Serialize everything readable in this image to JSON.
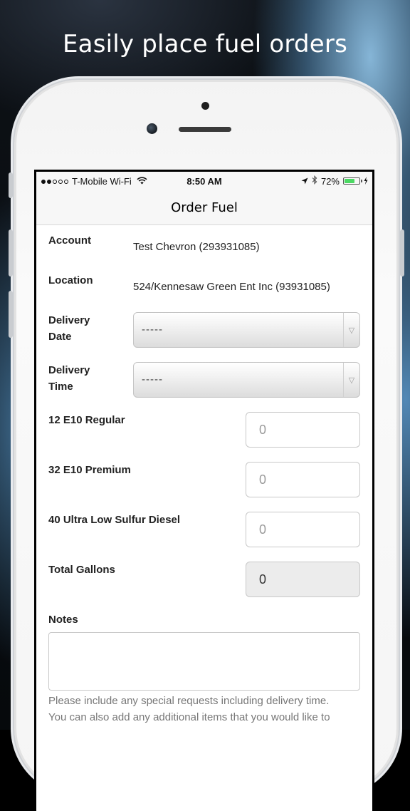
{
  "promo": {
    "headline": "Easily place fuel orders"
  },
  "status_bar": {
    "carrier": "T-Mobile Wi-Fi",
    "time": "8:50 AM",
    "battery": "72%",
    "battery_level": 0.72,
    "battery_color": "#4cd964",
    "icons": [
      "signal-dots-icon",
      "wifi-icon",
      "location-arrow-icon",
      "bluetooth-icon",
      "battery-icon",
      "charging-bolt-icon"
    ]
  },
  "navbar": {
    "title": "Order Fuel"
  },
  "form": {
    "account": {
      "label": "Account",
      "value": "Test Chevron (293931085)"
    },
    "location": {
      "label": "Location",
      "value": "524/Kennesaw Green Ent Inc (93931085)"
    },
    "delivery_date": {
      "label_line1": "Delivery",
      "label_line2": "Date",
      "selected": "-----"
    },
    "delivery_time": {
      "label_line1": "Delivery",
      "label_line2": "Time",
      "selected": "-----"
    },
    "products": [
      {
        "label": "12 E10 Regular",
        "placeholder": "0"
      },
      {
        "label": "32 E10 Premium",
        "placeholder": "0"
      },
      {
        "label": "40 Ultra Low Sulfur Diesel",
        "placeholder": "0"
      }
    ],
    "total": {
      "label": "Total Gallons",
      "value": "0"
    },
    "notes": {
      "label": "Notes",
      "value": "",
      "help_line1": "Please include any special requests including delivery time.",
      "help_line2": "You can also add any additional items that you would like to"
    }
  }
}
